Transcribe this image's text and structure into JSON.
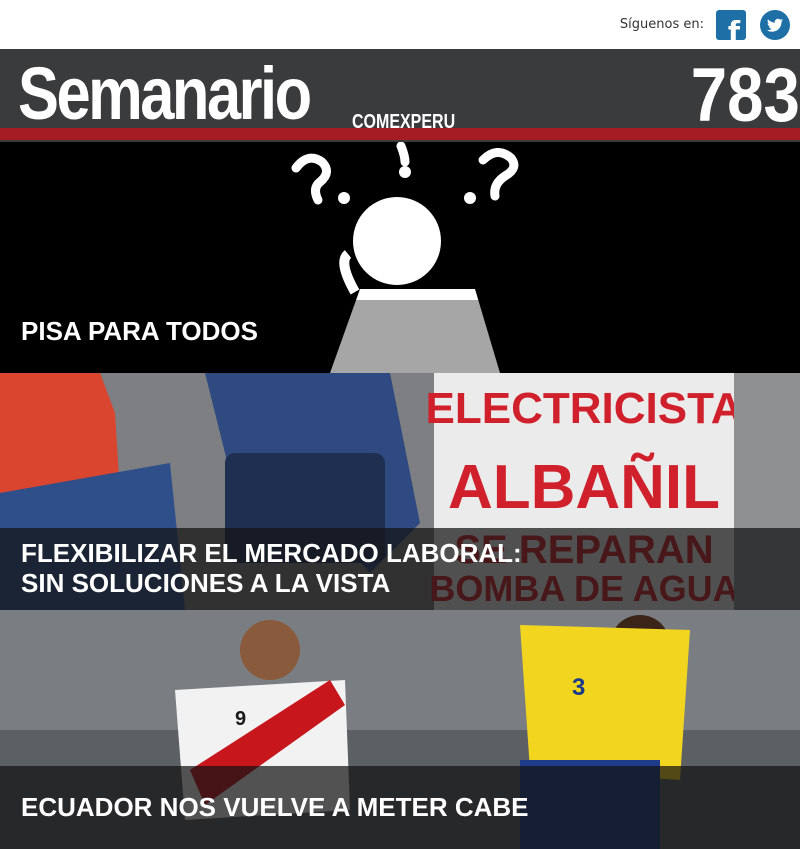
{
  "header": {
    "follow_label": "Síguenos en:",
    "facebook_icon": "facebook-icon",
    "twitter_icon": "twitter-icon"
  },
  "masthead": {
    "title": "Semanario",
    "brand": "COMEXPERU",
    "issue_number": "783"
  },
  "stories": [
    {
      "headline": "PISA PARA TODOS",
      "image": "thinking-person-with-question-marks"
    },
    {
      "headline_line1": "FLEXIBILIZAR EL MERCADO LABORAL:",
      "headline_line2": "SIN SOLUCIONES A LA VISTA",
      "image": "workers-sitting-with-sign",
      "sign_lines": [
        "ELECTRICISTA",
        "ALBAÑIL",
        "SE REPARAN",
        "BOMBA DE AGUA"
      ]
    },
    {
      "headline": "ECUADOR NOS VUELVE A METER CABE",
      "image": "peru-vs-ecuador-football-players",
      "jersey_numbers": [
        "9",
        "3"
      ]
    }
  ],
  "colors": {
    "masthead_bg": "#3a3b3d",
    "masthead_accent": "#a51c24",
    "social_blue": "#1d6fa5"
  }
}
